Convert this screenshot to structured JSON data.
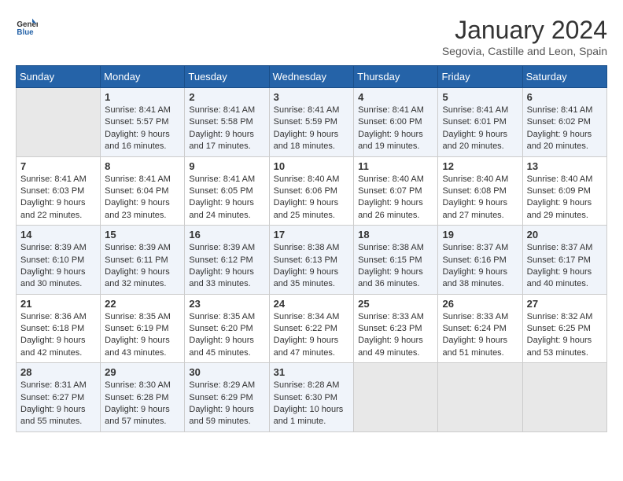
{
  "header": {
    "logo_line1": "General",
    "logo_line2": "Blue",
    "main_title": "January 2024",
    "subtitle": "Segovia, Castille and Leon, Spain"
  },
  "weekdays": [
    "Sunday",
    "Monday",
    "Tuesday",
    "Wednesday",
    "Thursday",
    "Friday",
    "Saturday"
  ],
  "weeks": [
    [
      {
        "day": "",
        "info": ""
      },
      {
        "day": "1",
        "info": "Sunrise: 8:41 AM\nSunset: 5:57 PM\nDaylight: 9 hours\nand 16 minutes."
      },
      {
        "day": "2",
        "info": "Sunrise: 8:41 AM\nSunset: 5:58 PM\nDaylight: 9 hours\nand 17 minutes."
      },
      {
        "day": "3",
        "info": "Sunrise: 8:41 AM\nSunset: 5:59 PM\nDaylight: 9 hours\nand 18 minutes."
      },
      {
        "day": "4",
        "info": "Sunrise: 8:41 AM\nSunset: 6:00 PM\nDaylight: 9 hours\nand 19 minutes."
      },
      {
        "day": "5",
        "info": "Sunrise: 8:41 AM\nSunset: 6:01 PM\nDaylight: 9 hours\nand 20 minutes."
      },
      {
        "day": "6",
        "info": "Sunrise: 8:41 AM\nSunset: 6:02 PM\nDaylight: 9 hours\nand 20 minutes."
      }
    ],
    [
      {
        "day": "7",
        "info": "Sunrise: 8:41 AM\nSunset: 6:03 PM\nDaylight: 9 hours\nand 22 minutes."
      },
      {
        "day": "8",
        "info": "Sunrise: 8:41 AM\nSunset: 6:04 PM\nDaylight: 9 hours\nand 23 minutes."
      },
      {
        "day": "9",
        "info": "Sunrise: 8:41 AM\nSunset: 6:05 PM\nDaylight: 9 hours\nand 24 minutes."
      },
      {
        "day": "10",
        "info": "Sunrise: 8:40 AM\nSunset: 6:06 PM\nDaylight: 9 hours\nand 25 minutes."
      },
      {
        "day": "11",
        "info": "Sunrise: 8:40 AM\nSunset: 6:07 PM\nDaylight: 9 hours\nand 26 minutes."
      },
      {
        "day": "12",
        "info": "Sunrise: 8:40 AM\nSunset: 6:08 PM\nDaylight: 9 hours\nand 27 minutes."
      },
      {
        "day": "13",
        "info": "Sunrise: 8:40 AM\nSunset: 6:09 PM\nDaylight: 9 hours\nand 29 minutes."
      }
    ],
    [
      {
        "day": "14",
        "info": "Sunrise: 8:39 AM\nSunset: 6:10 PM\nDaylight: 9 hours\nand 30 minutes."
      },
      {
        "day": "15",
        "info": "Sunrise: 8:39 AM\nSunset: 6:11 PM\nDaylight: 9 hours\nand 32 minutes."
      },
      {
        "day": "16",
        "info": "Sunrise: 8:39 AM\nSunset: 6:12 PM\nDaylight: 9 hours\nand 33 minutes."
      },
      {
        "day": "17",
        "info": "Sunrise: 8:38 AM\nSunset: 6:13 PM\nDaylight: 9 hours\nand 35 minutes."
      },
      {
        "day": "18",
        "info": "Sunrise: 8:38 AM\nSunset: 6:15 PM\nDaylight: 9 hours\nand 36 minutes."
      },
      {
        "day": "19",
        "info": "Sunrise: 8:37 AM\nSunset: 6:16 PM\nDaylight: 9 hours\nand 38 minutes."
      },
      {
        "day": "20",
        "info": "Sunrise: 8:37 AM\nSunset: 6:17 PM\nDaylight: 9 hours\nand 40 minutes."
      }
    ],
    [
      {
        "day": "21",
        "info": "Sunrise: 8:36 AM\nSunset: 6:18 PM\nDaylight: 9 hours\nand 42 minutes."
      },
      {
        "day": "22",
        "info": "Sunrise: 8:35 AM\nSunset: 6:19 PM\nDaylight: 9 hours\nand 43 minutes."
      },
      {
        "day": "23",
        "info": "Sunrise: 8:35 AM\nSunset: 6:20 PM\nDaylight: 9 hours\nand 45 minutes."
      },
      {
        "day": "24",
        "info": "Sunrise: 8:34 AM\nSunset: 6:22 PM\nDaylight: 9 hours\nand 47 minutes."
      },
      {
        "day": "25",
        "info": "Sunrise: 8:33 AM\nSunset: 6:23 PM\nDaylight: 9 hours\nand 49 minutes."
      },
      {
        "day": "26",
        "info": "Sunrise: 8:33 AM\nSunset: 6:24 PM\nDaylight: 9 hours\nand 51 minutes."
      },
      {
        "day": "27",
        "info": "Sunrise: 8:32 AM\nSunset: 6:25 PM\nDaylight: 9 hours\nand 53 minutes."
      }
    ],
    [
      {
        "day": "28",
        "info": "Sunrise: 8:31 AM\nSunset: 6:27 PM\nDaylight: 9 hours\nand 55 minutes."
      },
      {
        "day": "29",
        "info": "Sunrise: 8:30 AM\nSunset: 6:28 PM\nDaylight: 9 hours\nand 57 minutes."
      },
      {
        "day": "30",
        "info": "Sunrise: 8:29 AM\nSunset: 6:29 PM\nDaylight: 9 hours\nand 59 minutes."
      },
      {
        "day": "31",
        "info": "Sunrise: 8:28 AM\nSunset: 6:30 PM\nDaylight: 10 hours\nand 1 minute."
      },
      {
        "day": "",
        "info": ""
      },
      {
        "day": "",
        "info": ""
      },
      {
        "day": "",
        "info": ""
      }
    ]
  ]
}
